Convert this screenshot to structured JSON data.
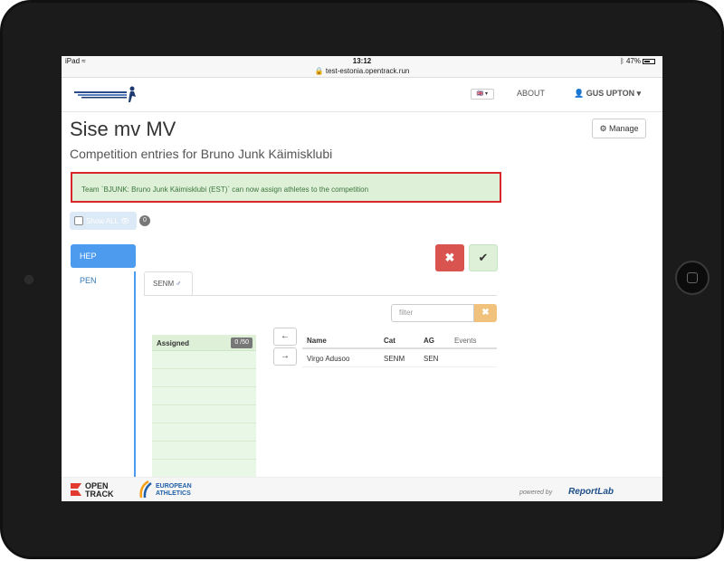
{
  "statusbar": {
    "device": "iPad",
    "time": "13:12",
    "battery": "47%"
  },
  "browser": {
    "url": "test-estonia.opentrack.run"
  },
  "navbar": {
    "flag": "🇬🇧 ▾",
    "about": "ABOUT",
    "user": "GUS UPTON ▾"
  },
  "page": {
    "title": "Sise mv MV",
    "subtitle": "Competition entries for Bruno Junk Käimisklubi",
    "manage": "Manage"
  },
  "alert": {
    "text": "Team `BJUNK: Bruno Junk Käimisklubi (EST)` can now assign athletes to the competition"
  },
  "show_all": {
    "label": "Show ALL",
    "count": "0"
  },
  "events": [
    "HEP",
    "PEN"
  ],
  "category_tab": "SENM",
  "filter": {
    "placeholder": "filter"
  },
  "assigned": {
    "label": "Assigned",
    "count": "0 /50"
  },
  "table": {
    "headers": [
      "Name",
      "Cat",
      "AG",
      "Events"
    ],
    "rows": [
      {
        "name": "Virgo Adusoo",
        "cat": "SENM",
        "ag": "SEN",
        "events": ""
      }
    ]
  },
  "footer": {
    "powered": "powered by",
    "brand": "ReportLab"
  },
  "colors": {
    "primary": "#4c9bef",
    "danger": "#d9534f",
    "success_bg": "#dff0d8",
    "warning": "#f0c27b",
    "alert_border": "#d9262a"
  }
}
